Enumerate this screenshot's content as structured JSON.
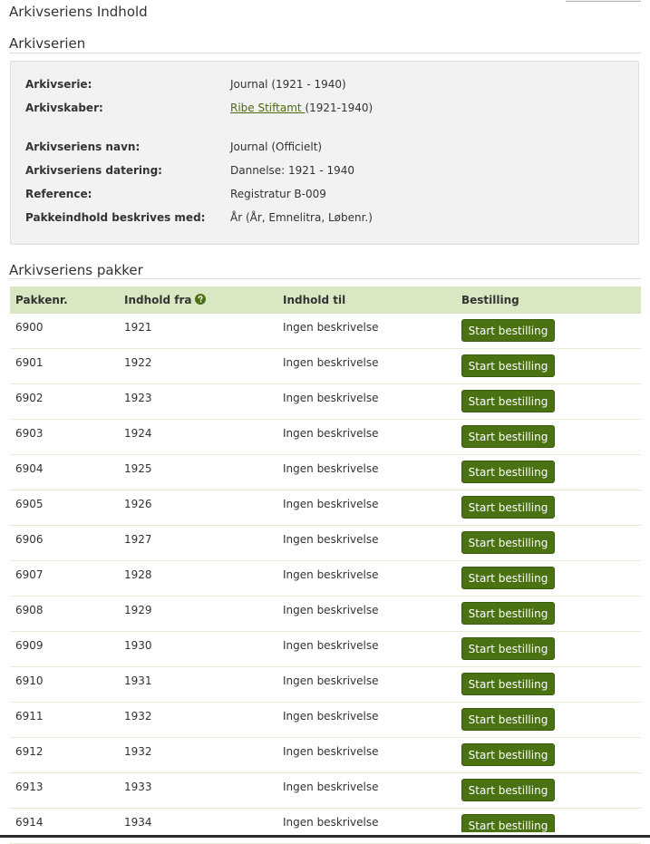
{
  "page": {
    "title": "Arkivseriens Indhold"
  },
  "series_section": {
    "title": "Arkivserien",
    "rows": [
      {
        "label": "Arkivserie:",
        "value": "Journal (1921 - 1940)"
      },
      {
        "label": "Arkivskaber:",
        "link": "Ribe Stiftamt ",
        "value": "(1921-1940)"
      },
      {
        "label": "Arkivseriens navn:",
        "value": "Journal (Officielt)"
      },
      {
        "label": "Arkivseriens datering:",
        "value": "Dannelse: 1921 - 1940"
      },
      {
        "label": "Reference:",
        "value": "Registratur B-009"
      },
      {
        "label": "Pakkeindhold beskrives med:",
        "value": "År (År, Emnelitra, Løbenr.)"
      }
    ]
  },
  "packages_section": {
    "title": "Arkivseriens pakker",
    "headers": {
      "pkg": "Pakkenr.",
      "from": "Indhold fra",
      "to": "Indhold til",
      "order": "Bestilling"
    },
    "help_icon": "question-circle-icon",
    "button_label": "Start bestilling",
    "rows": [
      {
        "pkg": "6900",
        "from": "1921",
        "to": "Ingen beskrivelse"
      },
      {
        "pkg": "6901",
        "from": "1922",
        "to": "Ingen beskrivelse"
      },
      {
        "pkg": "6902",
        "from": "1923",
        "to": "Ingen beskrivelse"
      },
      {
        "pkg": "6903",
        "from": "1924",
        "to": "Ingen beskrivelse"
      },
      {
        "pkg": "6904",
        "from": "1925",
        "to": "Ingen beskrivelse"
      },
      {
        "pkg": "6905",
        "from": "1926",
        "to": "Ingen beskrivelse"
      },
      {
        "pkg": "6906",
        "from": "1927",
        "to": "Ingen beskrivelse"
      },
      {
        "pkg": "6907",
        "from": "1928",
        "to": "Ingen beskrivelse"
      },
      {
        "pkg": "6908",
        "from": "1929",
        "to": "Ingen beskrivelse"
      },
      {
        "pkg": "6909",
        "from": "1930",
        "to": "Ingen beskrivelse"
      },
      {
        "pkg": "6910",
        "from": "1931",
        "to": "Ingen beskrivelse"
      },
      {
        "pkg": "6911",
        "from": "1932",
        "to": "Ingen beskrivelse"
      },
      {
        "pkg": "6912",
        "from": "1932",
        "to": "Ingen beskrivelse"
      },
      {
        "pkg": "6913",
        "from": "1933",
        "to": "Ingen beskrivelse"
      },
      {
        "pkg": "6914",
        "from": "1934",
        "to": "Ingen beskrivelse"
      }
    ]
  },
  "colors": {
    "header_bg": "#d9e8c2",
    "button_bg": "#4a7212",
    "link": "#4c6b10",
    "info_box_bg": "#f2f2f2"
  }
}
